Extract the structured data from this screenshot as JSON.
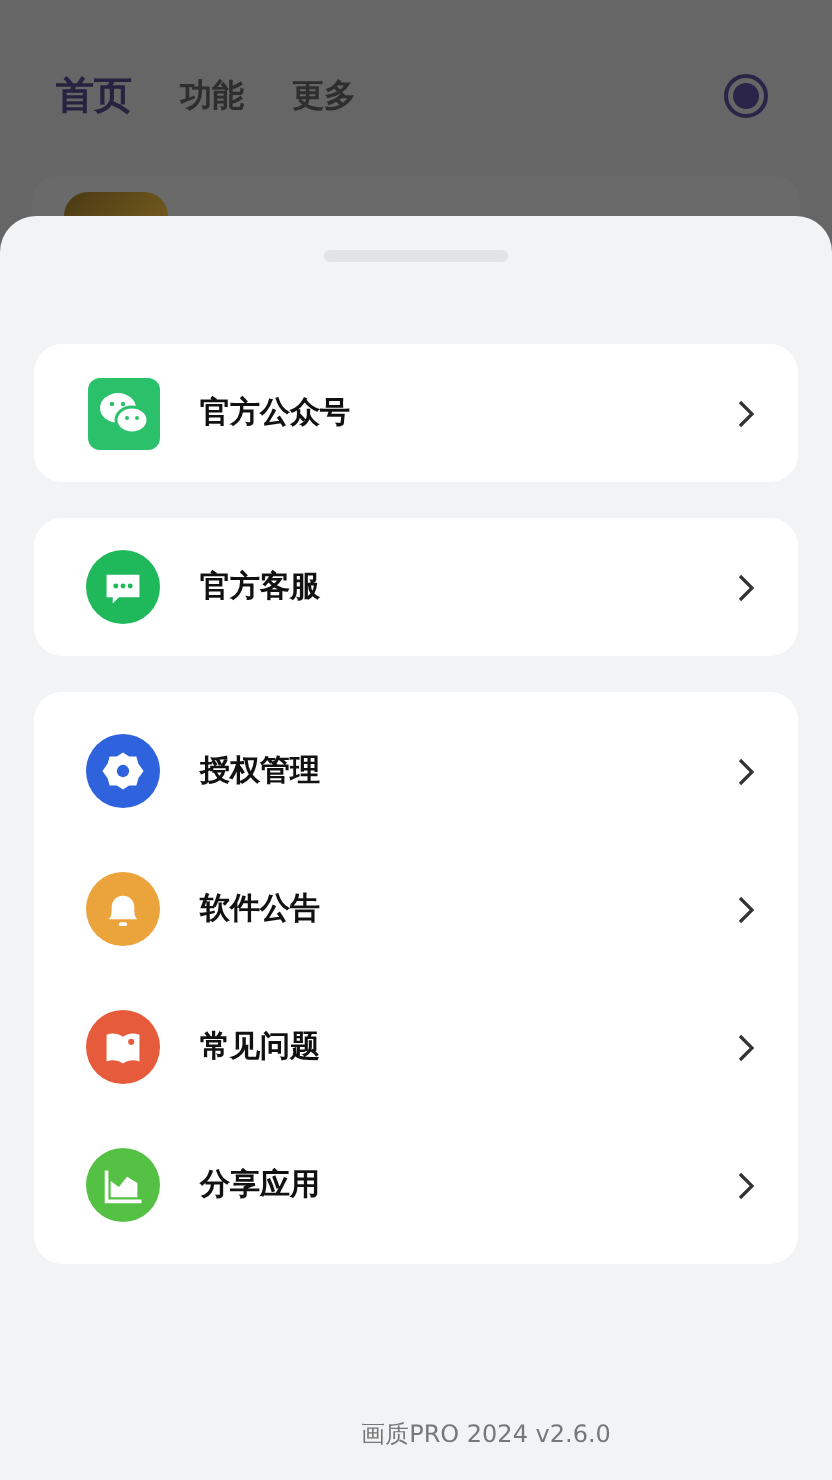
{
  "tabs": [
    {
      "label": "首页",
      "selected": true
    },
    {
      "label": "功能",
      "selected": false
    },
    {
      "label": "更多",
      "selected": false
    }
  ],
  "sheet": {
    "groups": [
      {
        "items": [
          {
            "label": "官方公众号",
            "kind": "wechat",
            "color": "#2bc16b"
          }
        ]
      },
      {
        "items": [
          {
            "label": "官方客服",
            "kind": "chat",
            "color": "#1fb95c"
          }
        ]
      },
      {
        "items": [
          {
            "label": "授权管理",
            "kind": "gear",
            "color": "#2f62dd"
          },
          {
            "label": "软件公告",
            "kind": "bell",
            "color": "#eba33c"
          },
          {
            "label": "常见问题",
            "kind": "book",
            "color": "#e65b3b"
          },
          {
            "label": "分享应用",
            "kind": "chart",
            "color": "#55c144"
          }
        ]
      }
    ],
    "footer": "画质PRO 2024 v2.6.0"
  }
}
